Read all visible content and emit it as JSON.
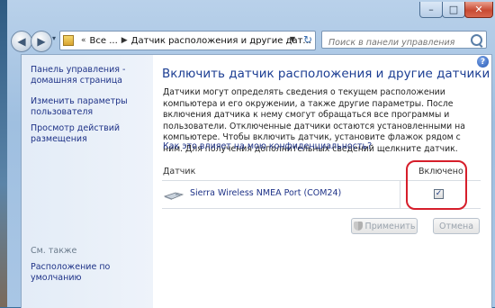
{
  "window": {
    "buttons": {
      "minimize": "–",
      "maximize": "□",
      "close": "✕"
    }
  },
  "nav": {
    "back": "◀",
    "forward": "▶",
    "history": "▾",
    "breadcrumb": [
      "Все ...",
      "Датчик расположения и другие дат..."
    ],
    "search_placeholder": "Поиск в панели управления"
  },
  "sidebar": {
    "links": [
      "Панель управления - домашняя страница",
      "Изменить параметры пользователя",
      "Просмотр действий размещения"
    ],
    "see_also_caption": "См. также",
    "see_also_links": [
      "Расположение по умолчанию"
    ]
  },
  "main": {
    "title": "Включить датчик расположения и другие датчики",
    "description": "Датчики могут определять сведения о текущем расположении компьютера и его окружении, а также другие параметры. После включения датчика к нему смогут обращаться все программы и пользователи. Отключенные датчики остаются установленными на компьютере. Чтобы включить датчик, установите флажок рядом с ним. Для получения дополнительных сведений щелкните датчик.",
    "privacy_link": "Как это влияет на мою конфиденциальность?",
    "table": {
      "columns": [
        "Датчик",
        "Включено"
      ],
      "rows": [
        {
          "name": "Sierra Wireless NMEA Port (COM24)",
          "enabled": "✓"
        }
      ]
    },
    "apply_label": "Применить",
    "cancel_label": "Отмена"
  },
  "colors": {
    "accent_link": "#1e3287",
    "title": "#1c3e93",
    "highlight": "#d61e2b"
  }
}
